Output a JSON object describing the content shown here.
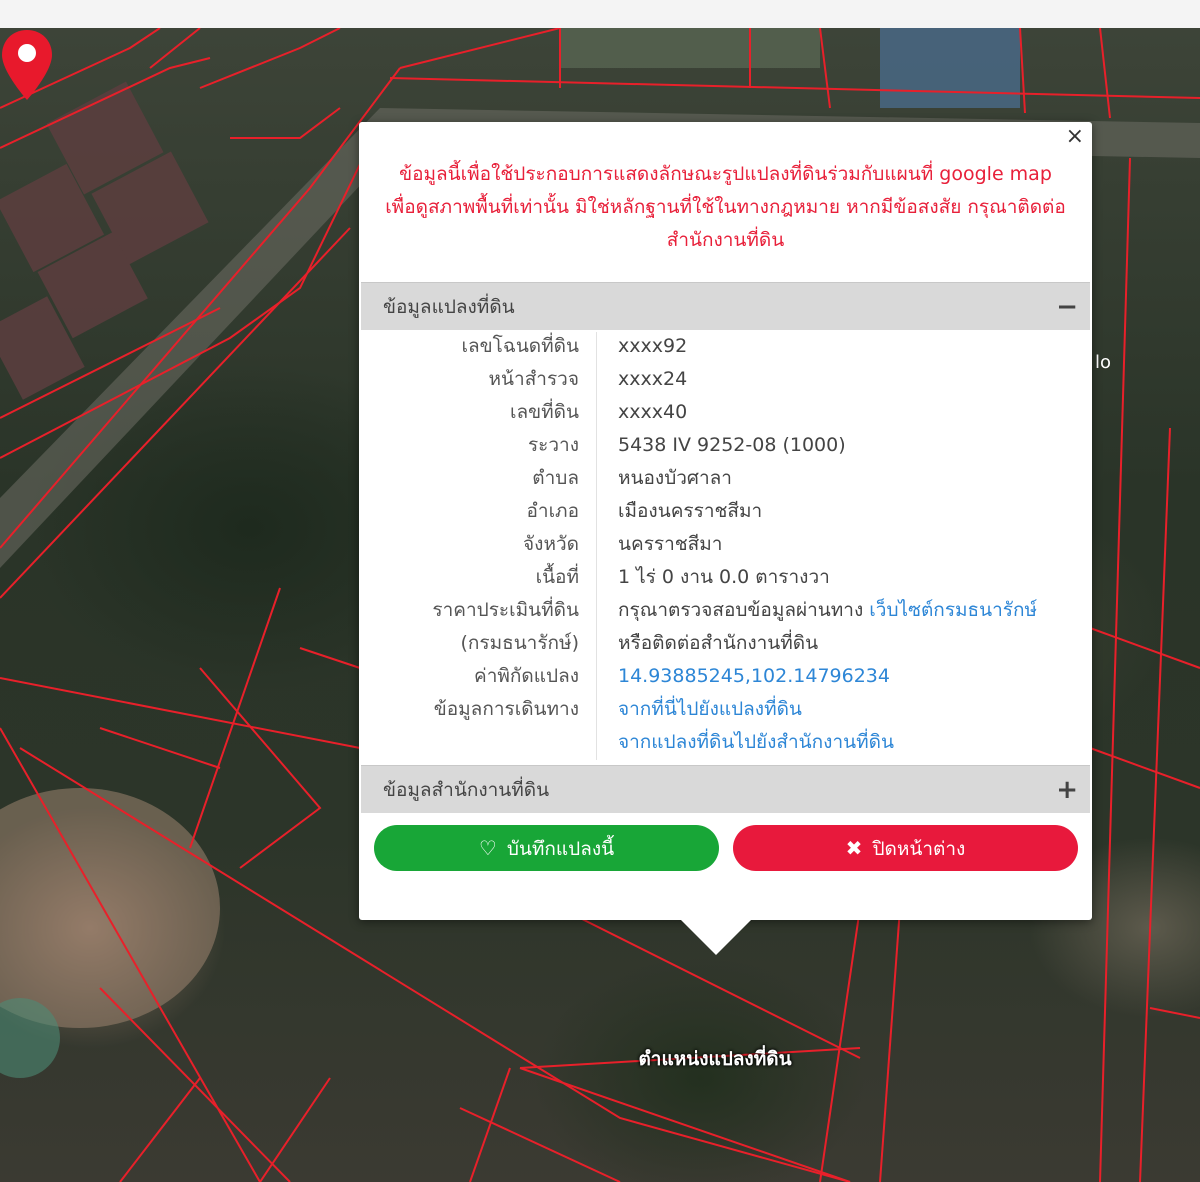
{
  "popup": {
    "disclaimer": [
      "ข้อมูลนี้เพื่อใช้ประกอบการแสดงลักษณะรูปแปลงที่ดินร่วมกับแผนที่ google map",
      "เพื่อดูสภาพพื้นที่เท่านั้น มิใช่หลักฐานที่ใช้ในทางกฎหมาย หากมีข้อสงสัย กรุณาติดต่อ",
      "สำนักงานที่ดิน"
    ],
    "close_symbol": "×",
    "parcel_section": {
      "title": "ข้อมูลแปลงที่ดิน",
      "toggle": "−"
    },
    "parcel_info": {
      "deed_no_label": "เลขโฉนดที่ดิน",
      "deed_no": "xxxx92",
      "survey_page_label": "หน้าสำรวจ",
      "survey_page": "xxxx24",
      "land_no_label": "เลขที่ดิน",
      "land_no": "xxxx40",
      "sheet_label": "ระวาง",
      "sheet": "5438 IV 9252-08 (1000)",
      "subdistrict_label": "ตำบล",
      "subdistrict": "หนองบัวศาลา",
      "district_label": "อำเภอ",
      "district": "เมืองนครราชสีมา",
      "province_label": "จังหวัด",
      "province": "นครราชสีมา",
      "area_label": "เนื้อที่",
      "area": "1 ไร่ 0 งาน 0.0 ตารางวา",
      "price_label_1": "ราคาประเมินที่ดิน",
      "price_label_2": "(กรมธนารักษ์)",
      "price_text_1": "กรุณาตรวจสอบข้อมูลผ่านทาง",
      "price_link": "เว็บไซต์กรมธนารักษ์",
      "price_text_2": "หรือติดต่อสำนักงานที่ดิน",
      "coords_label": "ค่าพิกัดแปลง",
      "coords": "14.93885245,102.14796234",
      "travel_label": "ข้อมูลการเดินทาง",
      "travel_link_1": "จากที่นี่ไปยังแปลงที่ดิน",
      "travel_link_2": "จากแปลงที่ดินไปยังสำนักงานที่ดิน"
    },
    "office_section": {
      "title": "ข้อมูลสำนักงานที่ดิน",
      "toggle": "+"
    },
    "buttons": {
      "save_icon": "♡",
      "save_label": "บันทึกแปลงนี้",
      "close_icon": "✖",
      "close_label": "ปิดหน้าต่าง"
    }
  },
  "map": {
    "marker_label": "ตำแหน่งแปลงที่ดิน",
    "boundary_color": "#e8202a",
    "marker_color": "#e8192c"
  }
}
